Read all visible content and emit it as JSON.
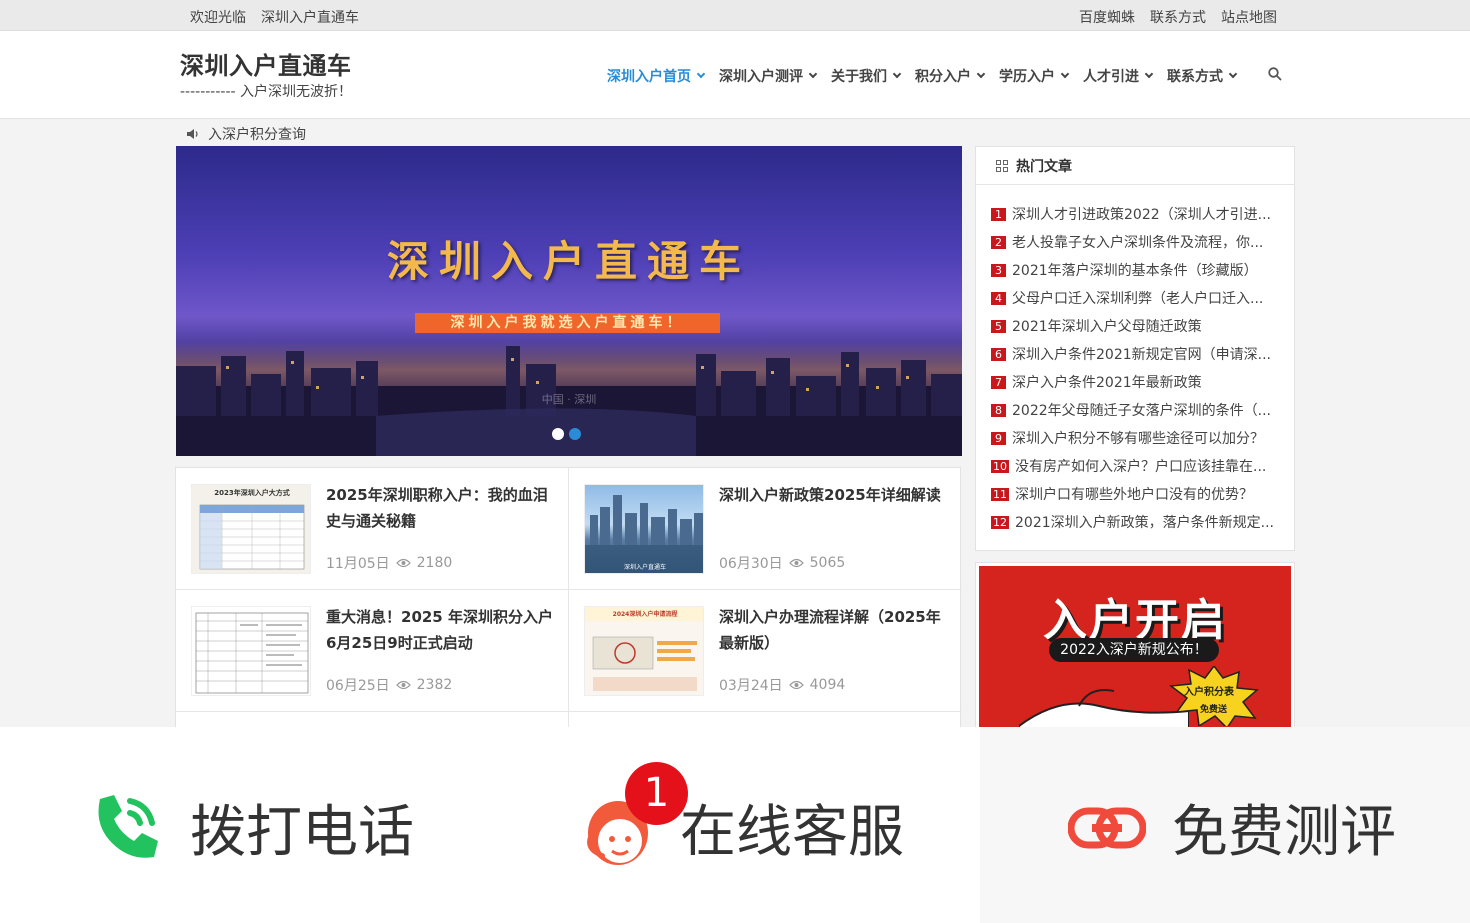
{
  "topbar": {
    "welcome": "欢迎光临",
    "site_name": "深圳入户直通车",
    "links": [
      "百度蜘蛛",
      "联系方式",
      "站点地图"
    ]
  },
  "header": {
    "title": "深圳入户直通车",
    "subtitle": "----------- 入户深圳无波折！"
  },
  "nav": {
    "items": [
      "深圳入户首页",
      "深圳入户测评",
      "关于我们",
      "积分入户",
      "学历入户",
      "人才引进",
      "联系方式"
    ],
    "active_index": 0
  },
  "notice": {
    "text": "入深户积分查询"
  },
  "banner": {
    "title": "深圳入户直通车",
    "subtitle": "深圳入户我就选入户直通车！",
    "caption": "中国 · 深圳",
    "slide_count": 2,
    "active_slide": 2
  },
  "articles": [
    {
      "title": "2025年深圳职称入户：我的血泪史与通关秘籍",
      "date": "11月05日",
      "views": "2180",
      "thumb_label": "2023年深圳入户大方式"
    },
    {
      "title": "深圳入户新政策2025年详细解读",
      "date": "06月30日",
      "views": "5065",
      "thumb_label": "深圳入户直通车"
    },
    {
      "title": "重大消息！2025 年深圳积分入户6月25日9时正式启动",
      "date": "06月25日",
      "views": "2382",
      "thumb_label": ""
    },
    {
      "title": "深圳入户办理流程详解（2025年最新版）",
      "date": "03月24日",
      "views": "4094",
      "thumb_label": "2024深圳入户申请流程"
    }
  ],
  "hot": {
    "heading": "热门文章",
    "items": [
      "深圳人才引进政策2022（深圳人才引进...",
      "老人投靠子女入户深圳条件及流程，你...",
      "2021年落户深圳的基本条件（珍藏版）",
      "父母户口迁入深圳利弊（老人户口迁入...",
      "2021年深圳入户父母随迁政策",
      "深圳入户条件2021新规定官网（申请深...",
      "深户入户条件2021年最新政策",
      "2022年父母随迁子女落户深圳的条件（...",
      "深圳入户积分不够有哪些途径可以加分？",
      "没有房产如何入深户？户口应该挂靠在...",
      "深圳户口有哪些外地户口没有的优势？",
      "2021深圳入户新政策，落户条件新规定..."
    ]
  },
  "ad": {
    "title": "入户开启",
    "pill": "2022入深户新规公布！",
    "burst_line1": "入户积分表",
    "burst_line2": "免费送"
  },
  "bottombar": {
    "call_label": "拨打电话",
    "service_label": "在线客服",
    "service_badge": "1",
    "eval_label": "免费测评",
    "colors": {
      "call": "#22c35e",
      "service": "#f25a3c",
      "eval": "#ef4a3c"
    }
  }
}
